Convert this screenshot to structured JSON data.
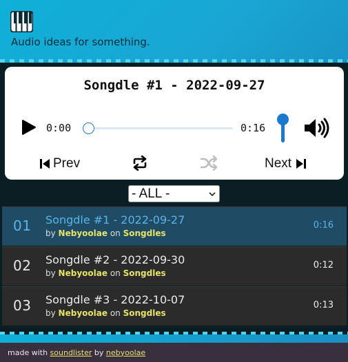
{
  "header": {
    "tagline": "Audio ideas for something.",
    "logo_icon": "piano-keys-icon",
    "accent": "#0fb0d8"
  },
  "player": {
    "title": "Songdle #1 - 2022-09-27",
    "current_time": "0:00",
    "total_time": "0:16",
    "progress": 0.0,
    "volume": 1.0,
    "prev_label": "Prev",
    "next_label": "Next",
    "icons": {
      "play": "play-icon",
      "prev": "skip-back-icon",
      "next": "skip-forward-icon",
      "repeat": "repeat-icon",
      "shuffle": "shuffle-icon",
      "volume": "speaker-icon"
    },
    "accent": "#1a78d0"
  },
  "filter": {
    "selected": "- ALL -"
  },
  "tracks": [
    {
      "num": "01",
      "title": "Songdle #1 - 2022-09-27",
      "by": "by",
      "artist": "Nebyoolae",
      "on": "on",
      "album": "Songdles",
      "duration": "0:16",
      "active": true
    },
    {
      "num": "02",
      "title": "Songdle #2 - 2022-09-30",
      "by": "by",
      "artist": "Nebyoolae",
      "on": "on",
      "album": "Songdles",
      "duration": "0:12",
      "active": false
    },
    {
      "num": "03",
      "title": "Songdle #3 - 2022-10-07",
      "by": "by",
      "artist": "Nebyoolae",
      "on": "on",
      "album": "Songdles",
      "duration": "0:13",
      "active": false
    }
  ],
  "footer": {
    "made_with": "made with",
    "tool_link": "soundlister",
    "by": "by",
    "author_link": "nebyoolae"
  }
}
